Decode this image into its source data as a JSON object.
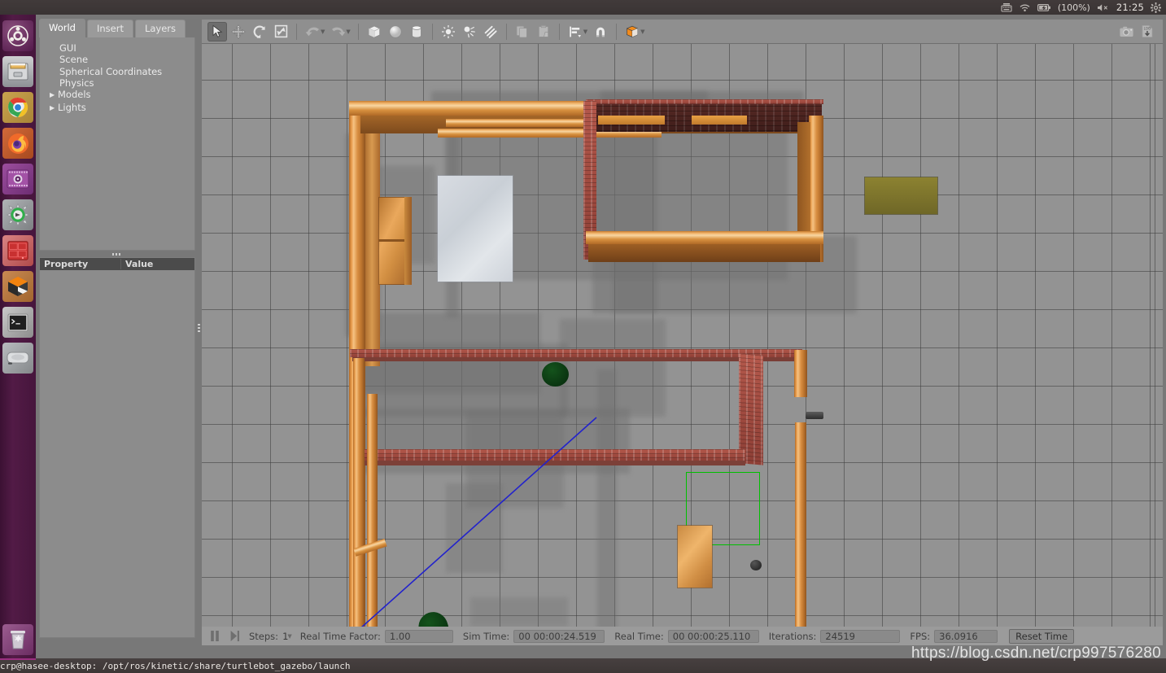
{
  "system": {
    "tray": [
      {
        "name": "keyboard-indicator-icon",
        "glyph": "keyboard"
      },
      {
        "name": "wifi-icon",
        "glyph": "wifi"
      },
      {
        "name": "battery-icon",
        "glyph": "battery"
      },
      {
        "name": "volume-muted-icon",
        "glyph": "volume-mute"
      },
      {
        "name": "settings-gear-icon",
        "glyph": "gear"
      }
    ],
    "battery_label": "(100%)",
    "volume_label": "x",
    "clock": "21:25"
  },
  "launcher": {
    "items": [
      {
        "name": "ubuntu-dash-icon",
        "label": "Ubuntu Dash"
      },
      {
        "name": "files-icon",
        "label": "Files"
      },
      {
        "name": "chrome-icon",
        "label": "Google Chrome"
      },
      {
        "name": "firefox-icon",
        "label": "Firefox"
      },
      {
        "name": "software-center-icon",
        "label": "Ubuntu Software"
      },
      {
        "name": "updates-icon",
        "label": "Software Updater"
      },
      {
        "name": "pycharm-icon",
        "label": "PyCharm"
      },
      {
        "name": "virtualbox-icon",
        "label": "VirtualBox"
      },
      {
        "name": "terminal-icon",
        "label": "Terminal"
      },
      {
        "name": "disk-icon",
        "label": "Disks"
      },
      {
        "name": "trash-icon",
        "label": "Trash"
      }
    ],
    "selected": "terminal-icon"
  },
  "left_panel": {
    "tabs": [
      {
        "id": "world",
        "label": "World",
        "active": true
      },
      {
        "id": "insert",
        "label": "Insert",
        "active": false
      },
      {
        "id": "layers",
        "label": "Layers",
        "active": false
      }
    ],
    "tree": [
      {
        "label": "GUI",
        "expandable": false
      },
      {
        "label": "Scene",
        "expandable": false
      },
      {
        "label": "Spherical Coordinates",
        "expandable": false
      },
      {
        "label": "Physics",
        "expandable": false
      },
      {
        "label": "Models",
        "expandable": true
      },
      {
        "label": "Lights",
        "expandable": true
      }
    ],
    "property_grid": {
      "col_property": "Property",
      "col_value": "Value",
      "rows": []
    }
  },
  "toolbar": {
    "left_tools": [
      {
        "name": "select-mode-icon",
        "label": "Selection Mode",
        "active": true,
        "disabled": false
      },
      {
        "name": "translate-mode-icon",
        "label": "Translation Mode",
        "active": false,
        "disabled": false
      },
      {
        "name": "rotate-mode-icon",
        "label": "Rotation Mode",
        "active": false,
        "disabled": false
      },
      {
        "name": "scale-mode-icon",
        "label": "Scale Mode",
        "active": false,
        "disabled": false
      }
    ],
    "history_tools": [
      {
        "name": "undo-icon",
        "label": "Undo",
        "disabled": true,
        "has_caret": true
      },
      {
        "name": "redo-icon",
        "label": "Redo",
        "disabled": true,
        "has_caret": true
      }
    ],
    "shape_tools": [
      {
        "name": "box-icon",
        "label": "Box"
      },
      {
        "name": "sphere-icon",
        "label": "Sphere"
      },
      {
        "name": "cylinder-icon",
        "label": "Cylinder"
      }
    ],
    "light_tools": [
      {
        "name": "point-light-icon",
        "label": "Point Light"
      },
      {
        "name": "spot-light-icon",
        "label": "Spot Light"
      },
      {
        "name": "directional-light-icon",
        "label": "Directional Light"
      }
    ],
    "clipboard_tools": [
      {
        "name": "copy-icon",
        "label": "Copy",
        "disabled": true
      },
      {
        "name": "paste-icon",
        "label": "Paste",
        "disabled": true
      }
    ],
    "align_tools": [
      {
        "name": "align-icon",
        "label": "Align",
        "has_caret": true
      },
      {
        "name": "snap-magnet-icon",
        "label": "Snap"
      }
    ],
    "view_tools": [
      {
        "name": "view-angle-icon",
        "label": "Change view angle",
        "has_caret": true
      }
    ],
    "right_tools": [
      {
        "name": "screenshot-camera-icon",
        "label": "Take a screenshot"
      },
      {
        "name": "log-record-icon",
        "label": "Log data"
      }
    ]
  },
  "sim_bar": {
    "pause_icon": "pause-icon",
    "step_icon": "step-forward-icon",
    "steps_label": "Steps:",
    "steps_value": "1",
    "rtf_label": "Real Time Factor:",
    "rtf_value": "1.00",
    "sim_time_label": "Sim Time:",
    "sim_time_value": "00 00:00:24.519",
    "real_time_label": "Real Time:",
    "real_time_value": "00 00:00:25.110",
    "iterations_label": "Iterations:",
    "iterations_value": "24519",
    "fps_label": "FPS:",
    "fps_value": "36.0916",
    "reset_label": "Reset Time"
  },
  "taskbar": {
    "window_title": "crp@hasee-desktop: /opt/ros/kinetic/share/turtlebot_gazebo/launch"
  },
  "watermark": {
    "text": "https://blog.csdn.net/crp997576280"
  },
  "colors": {
    "gazebo_panel": "#8c8c8c",
    "toolbar_bg": "#8f8f8f",
    "grid_ground": "#939393",
    "wood_accent": "#e79a4a",
    "brick_accent": "#b4584b",
    "selection_box": "#00c000",
    "laser_ray": "#2222cc",
    "accent_orange": "#f28b1c",
    "launcher_purple": "#521b46"
  },
  "scene": {
    "description": "Gazebo top-down view of turtlebot_gazebo house world",
    "selection_box_color": "#00c000",
    "laser_ray_color": "#2222cc",
    "objects": [
      {
        "name": "wood-wall-outer-left",
        "type": "wall",
        "material": "wood"
      },
      {
        "name": "wood-wall-top",
        "type": "wall",
        "material": "wood"
      },
      {
        "name": "brick-wall-top-right",
        "type": "wall",
        "material": "brick-dark"
      },
      {
        "name": "brick-wall-middle",
        "type": "wall",
        "material": "brick"
      },
      {
        "name": "bookshelf",
        "type": "furniture",
        "material": "wood"
      },
      {
        "name": "white-rug",
        "type": "floor-mat",
        "material": "cloth"
      },
      {
        "name": "olive-table",
        "type": "furniture",
        "material": "cloth"
      },
      {
        "name": "green-cylinder-a",
        "type": "obstacle",
        "material": "dark-green"
      },
      {
        "name": "green-cylinder-b",
        "type": "obstacle",
        "material": "dark-green"
      },
      {
        "name": "turtlebot-robot",
        "type": "robot",
        "material": "dark"
      },
      {
        "name": "cardboard-box",
        "type": "obstacle",
        "material": "wood-box"
      },
      {
        "name": "brick-doormat",
        "type": "floor-mat",
        "material": "brick"
      },
      {
        "name": "wood-floor-patch",
        "type": "floor",
        "material": "wood"
      }
    ]
  }
}
